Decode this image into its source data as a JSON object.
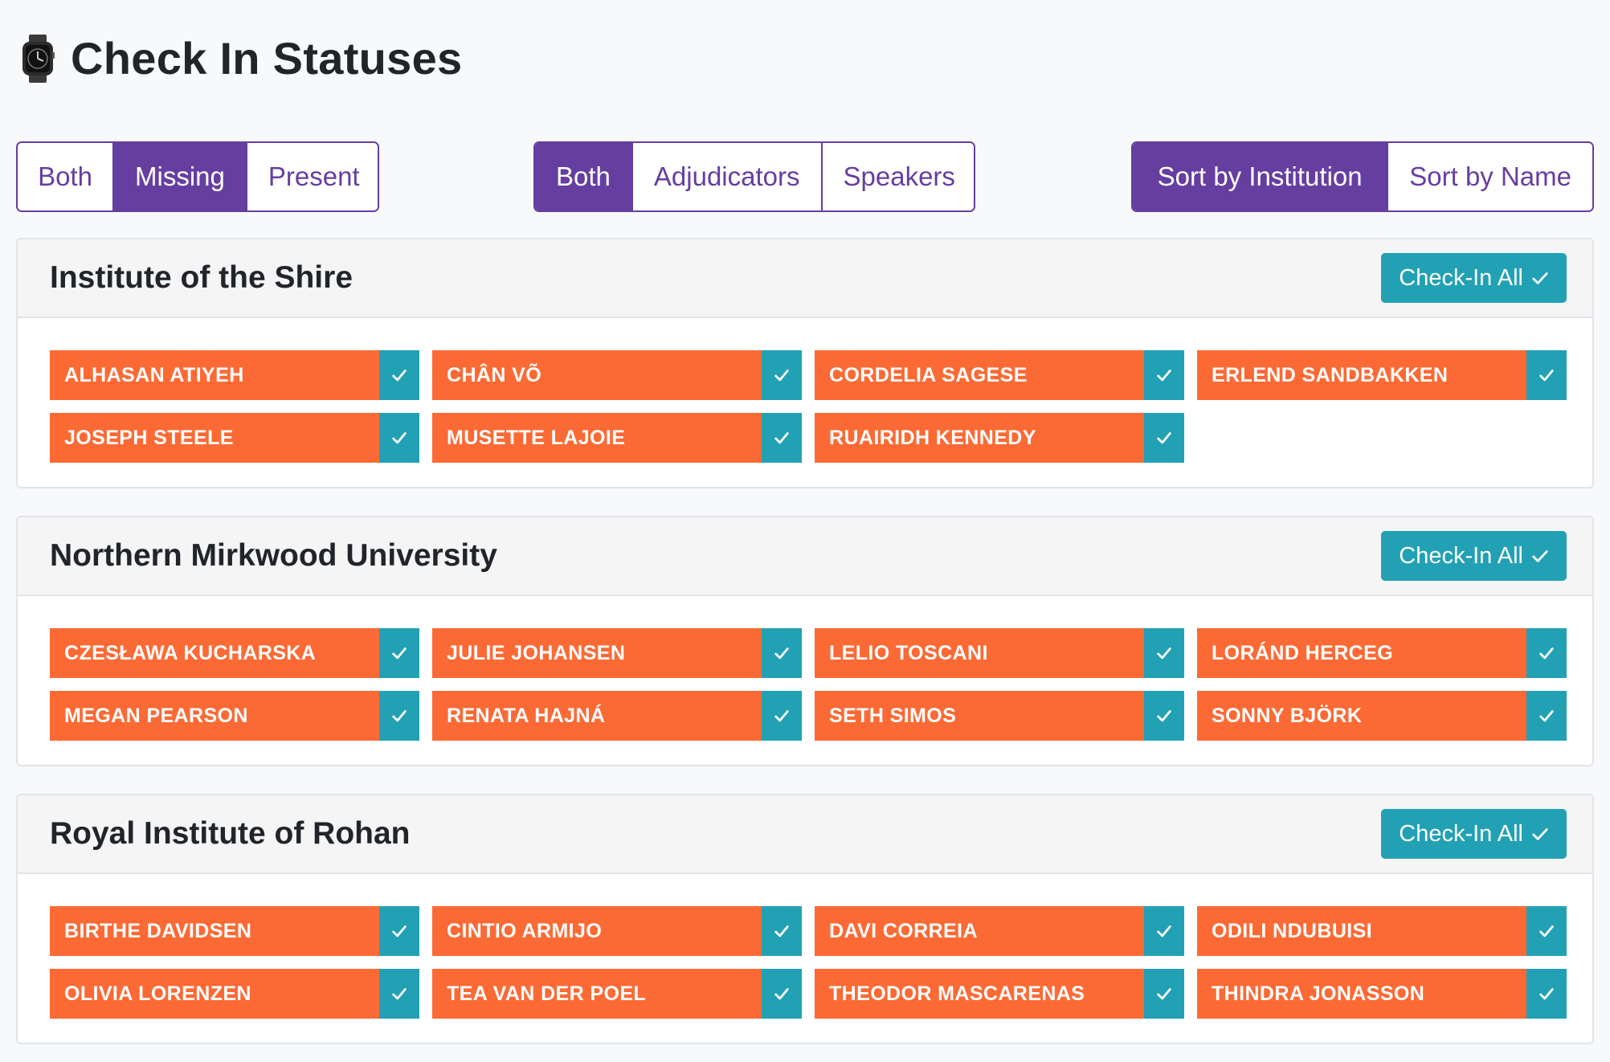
{
  "page": {
    "title": "Check In Statuses",
    "icon": "watch-icon"
  },
  "filters": {
    "status": {
      "options": [
        "Both",
        "Missing",
        "Present"
      ],
      "active": "Missing"
    },
    "type": {
      "options": [
        "Both",
        "Adjudicators",
        "Speakers"
      ],
      "active": "Both"
    },
    "sort": {
      "options": [
        "Sort by Institution",
        "Sort by Name"
      ],
      "active": "Sort by Institution"
    }
  },
  "check_in_all_label": "Check-In All",
  "colors": {
    "accent": "#663ea0",
    "missing": "#fb6a35",
    "check": "#23a1b4"
  },
  "institutions": [
    {
      "name": "Institute of the Shire",
      "people": [
        "ALHASAN ATIYEH",
        "CHÂN VÕ",
        "CORDELIA SAGESE",
        "ERLEND SANDBAKKEN",
        "JOSEPH STEELE",
        "MUSETTE LAJOIE",
        "RUAIRIDH KENNEDY"
      ]
    },
    {
      "name": "Northern Mirkwood University",
      "people": [
        "CZESŁAWA KUCHARSKA",
        "JULIE JOHANSEN",
        "LELIO TOSCANI",
        "LORÁND HERCEG",
        "MEGAN PEARSON",
        "RENATA HAJNÁ",
        "SETH SIMOS",
        "SONNY BJÖRK"
      ]
    },
    {
      "name": "Royal Institute of Rohan",
      "people": [
        "BIRTHE DAVIDSEN",
        "CINTIO ARMIJO",
        "DAVI CORREIA",
        "ODILI NDUBUISI",
        "OLIVIA LORENZEN",
        "TEA VAN DER POEL",
        "THEODOR MASCARENAS",
        "THINDRA JONASSON"
      ]
    }
  ]
}
